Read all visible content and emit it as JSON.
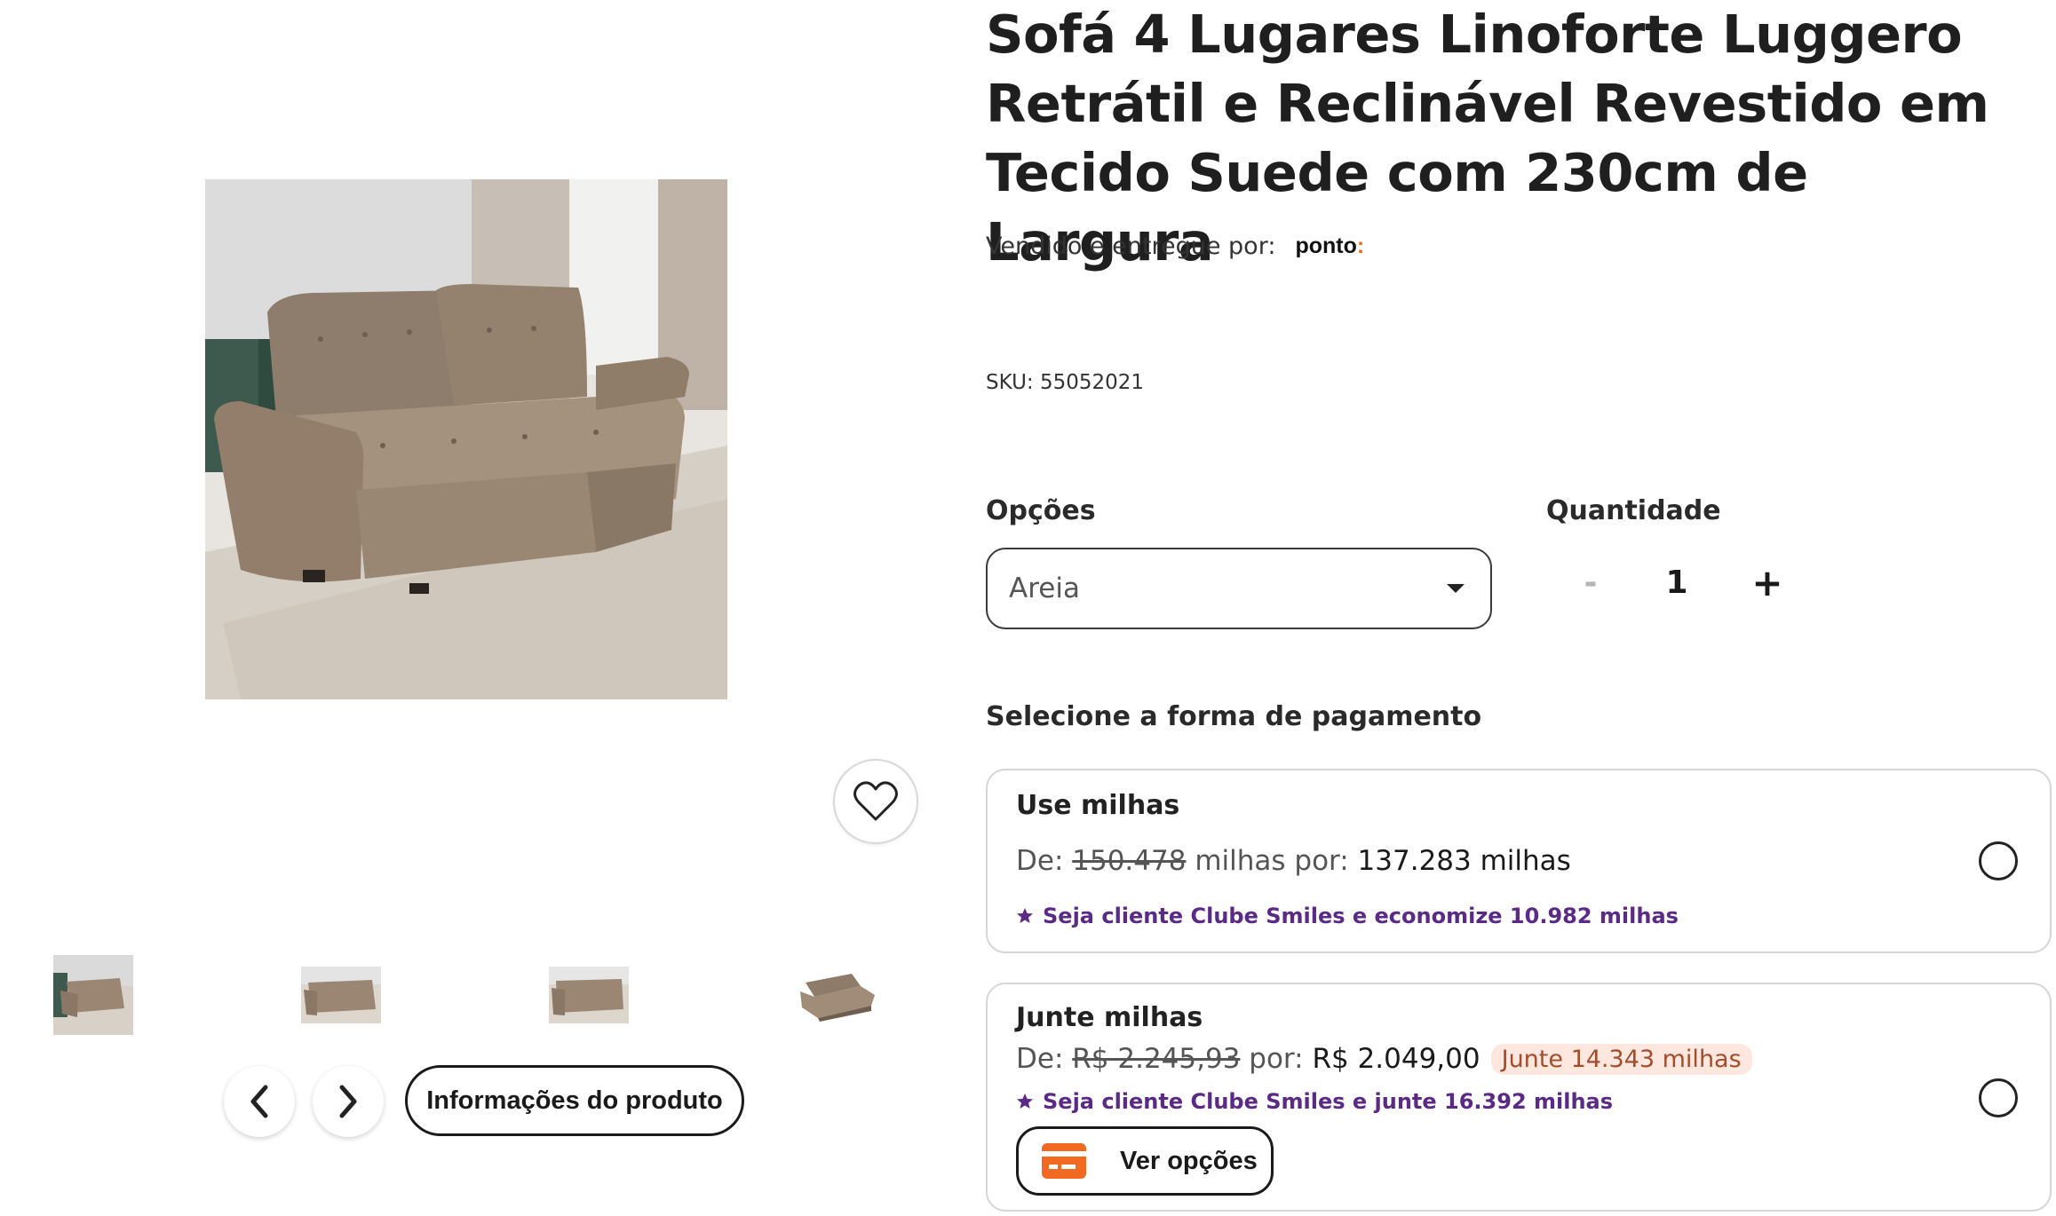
{
  "product": {
    "title": "Sofá 4 Lugares Linoforte Luggero Retrátil e Reclinável Revestido em Tecido Suede com 230cm de Largura",
    "seller_label": "Vendido e entregue por:",
    "seller_name": "ponto",
    "seller_name_dot": ":",
    "sku": "SKU: 55052021"
  },
  "gallery": {
    "main_image_alt": "sofa-image",
    "thumbnails": [
      "thumb-1",
      "thumb-2",
      "thumb-3",
      "thumb-4"
    ],
    "info_button": "Informações do produto",
    "icons": {
      "favorite": "heart-icon",
      "prev": "chevron-left-icon",
      "next": "chevron-right-icon"
    }
  },
  "options": {
    "label": "Opções",
    "selected": "Areia"
  },
  "quantity": {
    "label": "Quantidade",
    "minus": "-",
    "value": "1",
    "plus": "+"
  },
  "payment": {
    "title": "Selecione a forma de pagamento",
    "use_miles": {
      "heading": "Use milhas",
      "de": "De:",
      "old": "150.478",
      "mid": "milhas por:",
      "new": "137.283 milhas",
      "promo": "Seja cliente Clube Smiles e economize 10.982 milhas"
    },
    "join_miles": {
      "heading": "Junte milhas",
      "de": "De:",
      "old": "R$ 2.245,93",
      "mid": "por:",
      "new": "R$ 2.049,00",
      "pill": "Junte 14.343 milhas",
      "promo": "Seja cliente Clube Smiles e junte 16.392 milhas",
      "button": "Ver opções"
    }
  },
  "colors": {
    "promo_purple": "#5b2a86",
    "accent_orange": "#f26a21",
    "pill_bg": "#fde7df"
  }
}
